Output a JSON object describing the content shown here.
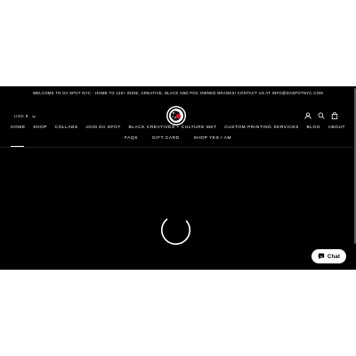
{
  "announcement": {
    "text": "WELCOME TO DA SPOT NYC - HOME TO 120+ INDIE, CREATIVE, BLACK AND POC OWNED BRANDS! CONTACT US AT INFO@DASPOTNYC.COM"
  },
  "header": {
    "currency": "USD $",
    "icons": [
      "account-icon",
      "search-icon",
      "cart-icon"
    ]
  },
  "nav": {
    "primary": [
      {
        "label": "HOME"
      },
      {
        "label": "SHOP"
      },
      {
        "label": "COLLABS"
      },
      {
        "label": "JOIN DA SPOT"
      },
      {
        "label": "BLACK CREATIVES + CULTURE MKT"
      },
      {
        "label": "CUSTOM PRINTING SERVICES"
      },
      {
        "label": "BLOG"
      },
      {
        "label": "ABOUT"
      }
    ],
    "secondary": [
      {
        "label": "FAQS"
      },
      {
        "label": "GIFT CARD"
      },
      {
        "label": "SHOP YES I AM"
      }
    ]
  },
  "chat": {
    "label": "Chat"
  },
  "colors": {
    "page_bg": "#000000",
    "text": "#ffffff",
    "chat_bg": "#ffffff"
  }
}
